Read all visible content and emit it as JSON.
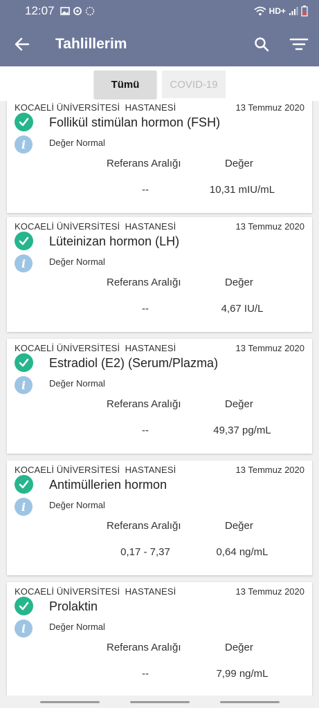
{
  "status_bar": {
    "time": "12:07",
    "network": "HD+",
    "icons_left": [
      "image-icon",
      "sync-icon",
      "circle-icon"
    ],
    "icons_right": [
      "wifi-icon",
      "signal-icon",
      "battery-icon"
    ]
  },
  "app_bar": {
    "title": "Tahlillerim",
    "background": "#6d7899"
  },
  "tabs": [
    {
      "label": "Tümü",
      "selected": true
    },
    {
      "label": "COVID-19",
      "selected": false
    }
  ],
  "labels": {
    "reference_range": "Referans Aralığı",
    "value": "Değer"
  },
  "results": [
    {
      "hospital": "KOCAELİ ÜNİVERSİTESİ  HASTANESİ",
      "date": "13 Temmuz 2020",
      "test": "Follikül stimülan hormon (FSH)",
      "status": "Değer Normal",
      "reference": "--",
      "value": "10,31 mIU/mL"
    },
    {
      "hospital": "KOCAELİ ÜNİVERSİTESİ  HASTANESİ",
      "date": "13 Temmuz 2020",
      "test": "Lüteinizan hormon (LH)",
      "status": "Değer Normal",
      "reference": "--",
      "value": "4,67 IU/L"
    },
    {
      "hospital": "KOCAELİ ÜNİVERSİTESİ  HASTANESİ",
      "date": "13 Temmuz 2020",
      "test": "Estradiol (E2) (Serum/Plazma)",
      "status": "Değer Normal",
      "reference": "--",
      "value": "49,37 pg/mL"
    },
    {
      "hospital": "KOCAELİ ÜNİVERSİTESİ  HASTANESİ",
      "date": "13 Temmuz 2020",
      "test": "Antimüllerien hormon",
      "status": "Değer Normal",
      "reference": "0,17 - 7,37",
      "value": "0,64 ng/mL"
    },
    {
      "hospital": "KOCAELİ ÜNİVERSİTESİ  HASTANESİ",
      "date": "13 Temmuz 2020",
      "test": "Prolaktin",
      "status": "Değer Normal",
      "reference": "--",
      "value": "7,99 ng/mL"
    }
  ]
}
